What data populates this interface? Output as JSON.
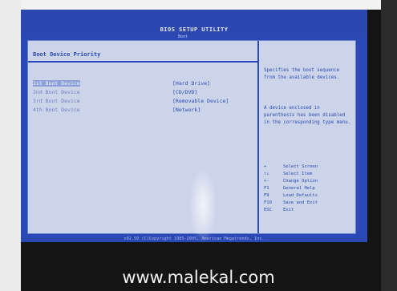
{
  "bios": {
    "title": "BIOS SETUP UTILITY",
    "tab": "Boot",
    "section_title": "Boot Device Priority",
    "devices": [
      {
        "label": "1st Boot Device",
        "value": "[Hard Drive]"
      },
      {
        "label": "2nd Boot Device",
        "value": "[CD/DVD]"
      },
      {
        "label": "3rd Boot Device",
        "value": "[Removable Device]"
      },
      {
        "label": "4th Boot Device",
        "value": "[Network]"
      }
    ],
    "help": {
      "para1": "Specifies the boot sequence from the available devices.",
      "para2": "A device enclosed in parenthesis has been disabled in the corresponding type menu."
    },
    "keys": [
      {
        "key": "↔",
        "desc": "Select Screen"
      },
      {
        "key": "↑↓",
        "desc": "Select Item"
      },
      {
        "key": "+-",
        "desc": "Change Option"
      },
      {
        "key": "F1",
        "desc": "General Help"
      },
      {
        "key": "F9",
        "desc": "Load Defaults"
      },
      {
        "key": "F10",
        "desc": "Save and Exit"
      },
      {
        "key": "ESC",
        "desc": "Exit"
      }
    ],
    "footer": "v02.59 (C)Copyright 1985-2005, American Megatrends, Inc."
  },
  "watermark": "www.malekal.com"
}
